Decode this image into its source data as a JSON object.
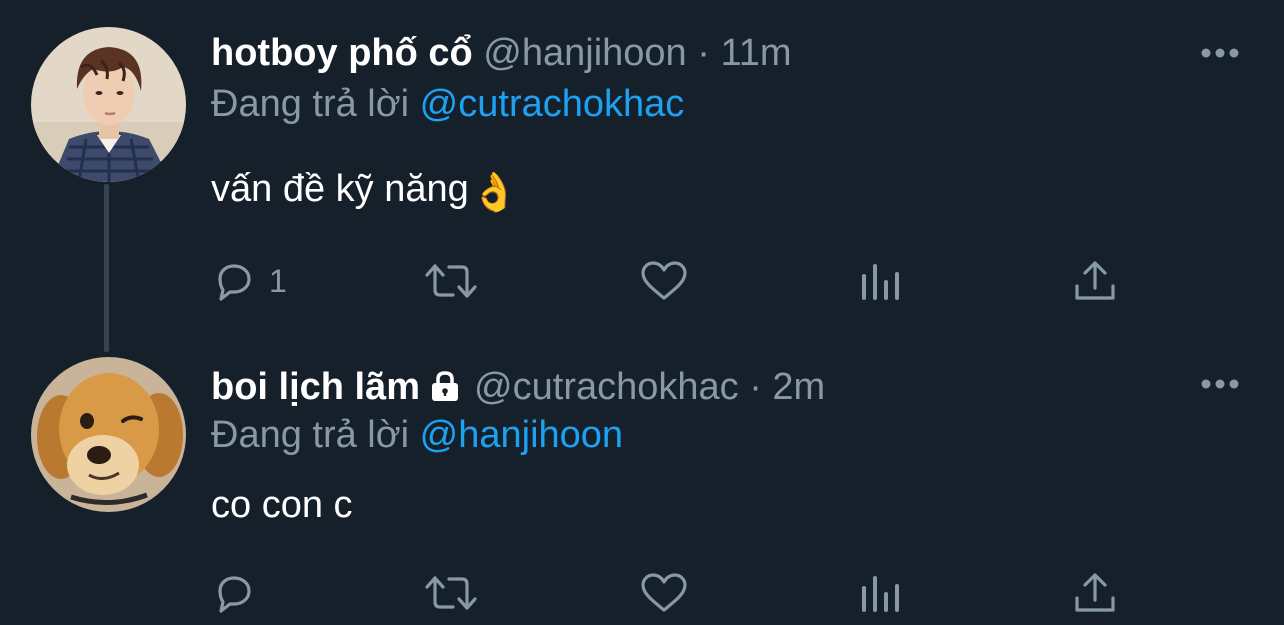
{
  "tweets": [
    {
      "display_name": "hotboy phố cổ",
      "handle": "@hanjihoon",
      "separator": "·",
      "time": "11m",
      "reply_prefix": "Đang trả lời",
      "reply_to": "@cutrachokhac",
      "text": "vấn đề kỹ năng",
      "emoji": "👌",
      "reply_count": "1",
      "avatar_icon": "avatar-photo-person",
      "protected": false
    },
    {
      "display_name": "boi lịch lãm",
      "handle": "@cutrachokhac",
      "separator": "·",
      "time": "2m",
      "reply_prefix": "Đang trả lời",
      "reply_to": "@hanjihoon",
      "text": "co con c",
      "reply_count": "",
      "avatar_icon": "avatar-photo-dog",
      "protected": true
    }
  ],
  "icons": {
    "reply": "reply-icon",
    "retweet": "retweet-icon",
    "like": "heart-icon",
    "stats": "stats-icon",
    "share": "share-icon",
    "more": "more-icon",
    "lock": "lock-icon"
  },
  "colors": {
    "background": "#15202b",
    "text": "#ffffff",
    "secondary": "#8899a6",
    "mention": "#1da1f2",
    "thread_line": "#38444d"
  }
}
